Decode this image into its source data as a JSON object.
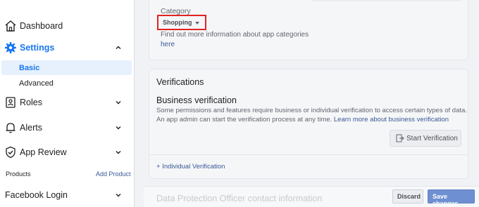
{
  "sidebar": {
    "dashboard": "Dashboard",
    "settings": "Settings",
    "basic": "Basic",
    "advanced": "Advanced",
    "roles": "Roles",
    "alerts": "Alerts",
    "app_review": "App Review",
    "products": "Products",
    "add_product": "Add Product",
    "facebook_login": "Facebook Login",
    "icons": [
      "home-icon",
      "gear-icon",
      "roles-icon",
      "bell-icon",
      "shield-check-icon",
      "chevron-icon"
    ],
    "accent_color": "#1877f2"
  },
  "category": {
    "label": "Category",
    "value": "Shopping",
    "help": "Find out more information about app categories",
    "here": "here"
  },
  "verifications": {
    "title": "Verifications",
    "business_title": "Business verification",
    "desc_line1": "Some permissions and features require business or individual verification to access certain types of data.",
    "desc_line2": "An app admin can start the verification process at any time.",
    "learn_more": "Learn more about business verification",
    "start_button": "Start Verification",
    "individual": "+ Individual Verification"
  },
  "footer": {
    "dpo_title": "Data Protection Officer contact information",
    "discard": "Discard",
    "save": "Save changes"
  }
}
